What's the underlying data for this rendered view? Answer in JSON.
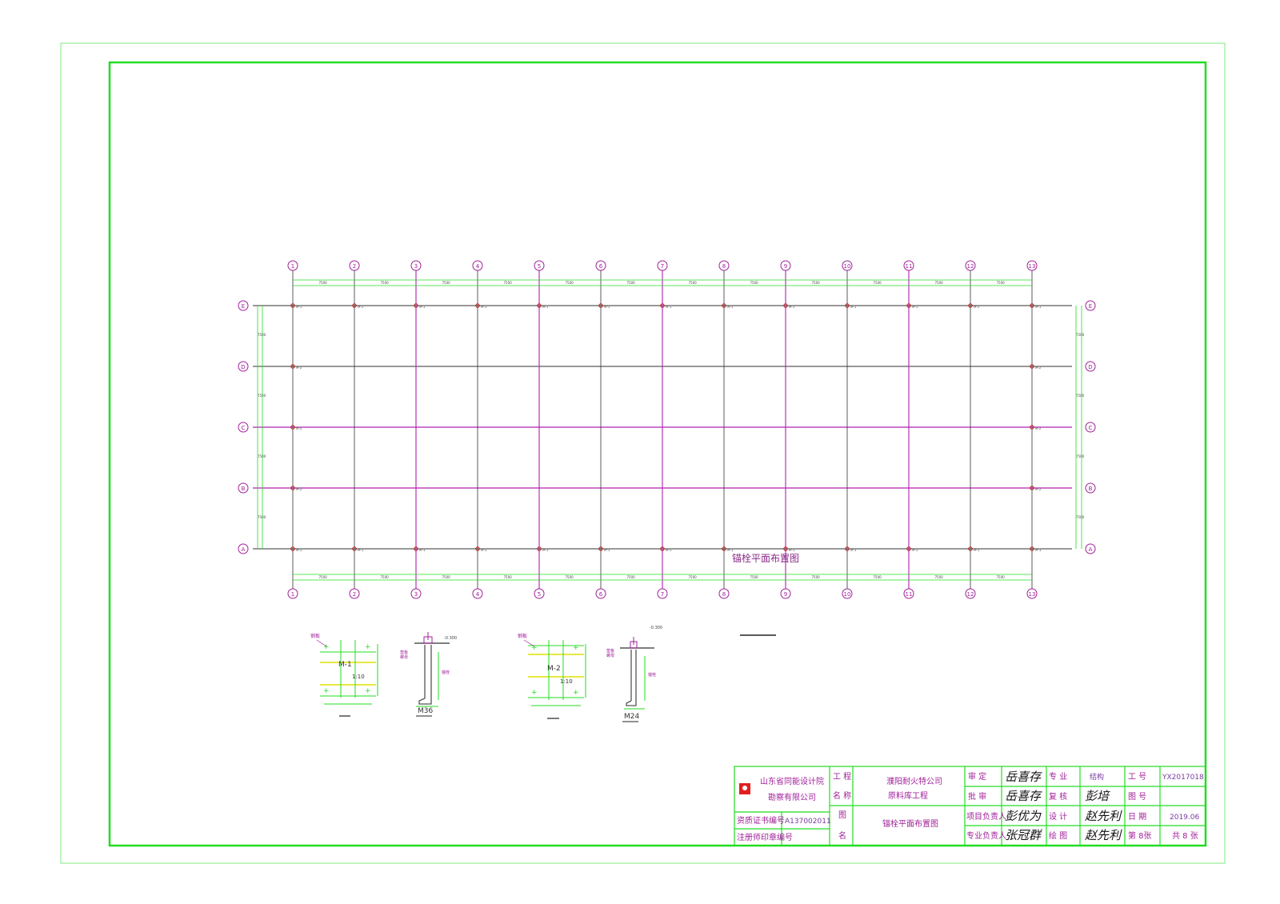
{
  "drawing": {
    "plan_title": "锚栓平面布置图",
    "axes_numbers": [
      "1",
      "2",
      "3",
      "4",
      "5",
      "6",
      "7",
      "8",
      "9",
      "10",
      "11",
      "12",
      "13"
    ],
    "axes_letters": [
      "E",
      "D",
      "C",
      "B",
      "A"
    ],
    "bay_labels": [
      "7500",
      "7500",
      "7500",
      "7500",
      "7500",
      "7500",
      "7500",
      "7500",
      "7500",
      "7500",
      "7500",
      "7500"
    ],
    "span_labels": [
      "7500",
      "7500",
      "7500",
      "7500"
    ],
    "column_tag_edge": "M-1",
    "column_tag_gable": "M-2"
  },
  "details": {
    "d1": {
      "plate": "M-1",
      "ratio": "1:10",
      "bolt": "M36",
      "elev": "-0.300"
    },
    "d2": {
      "plate": "M-2",
      "ratio": "1:10",
      "bolt": "M24",
      "elev": "-0.300"
    }
  },
  "title_block": {
    "company_line1": "山东省同能设计院",
    "company_line2": "勘察有限公司",
    "cert_label": "资质证书编号",
    "cert_value": "A137002011",
    "stamp_label": "注册师印章编号",
    "proj_label_a": "工 程",
    "proj_label_b": "名 称",
    "proj_line1": "濮阳耐火特公司",
    "proj_line2": "原料库工程",
    "drawing_label_a": "图",
    "drawing_label_b": "名",
    "drawing_name": "锚栓平面布置图",
    "roles": {
      "approve": "审 定",
      "review": "批 审",
      "pm": "项目负责人",
      "lead": "专业负责人",
      "major": "专 业",
      "check": "复 核",
      "design": "设 计",
      "draw": "绘 图"
    },
    "discipline": "结构",
    "labels": {
      "job": "工 号",
      "drawing_no": "图 号",
      "date": "日 期",
      "sheet": "第 8张"
    },
    "job_no": "YX2017018",
    "date": "2019.06",
    "total": "共 8 张",
    "signatures": [
      "岳喜存",
      "岳喜存",
      "彭优为",
      "张冠群",
      "彭培",
      "赵先利",
      "赵先利"
    ]
  },
  "colors": {
    "frame": "#22dd22",
    "grid": "#333333",
    "beam": "#b020b0",
    "bubble": "#a0209a"
  }
}
